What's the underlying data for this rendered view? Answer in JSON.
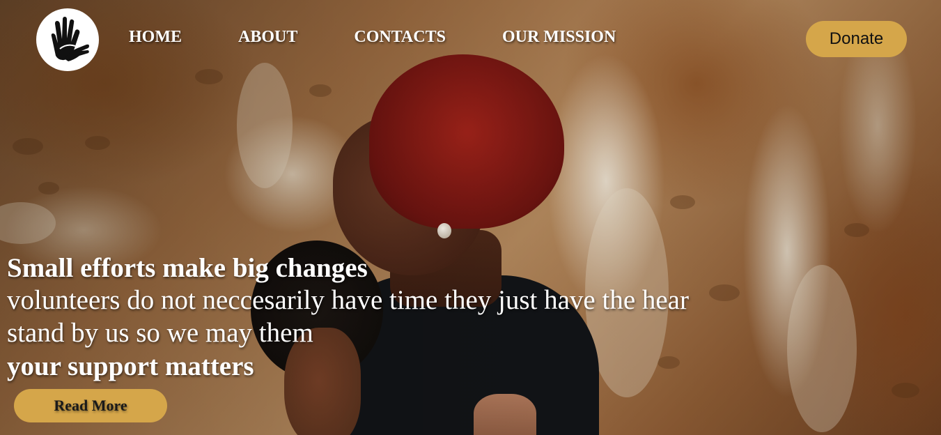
{
  "header": {
    "logo_icon": "hands-logo-icon",
    "nav": [
      {
        "label": "HOME"
      },
      {
        "label": "ABOUT"
      },
      {
        "label": "CONTACTS"
      },
      {
        "label": "OUR MISSION"
      }
    ],
    "donate_label": "Donate"
  },
  "hero": {
    "title": "Small efforts make big changes",
    "line1": "volunteers do not neccesarily have time they just have the hear",
    "line2": "stand by us so we may them",
    "strong": "your support matters",
    "read_more_label": "Read More"
  },
  "colors": {
    "accent": "#d5a64a",
    "nav_text": "#ffffff"
  }
}
